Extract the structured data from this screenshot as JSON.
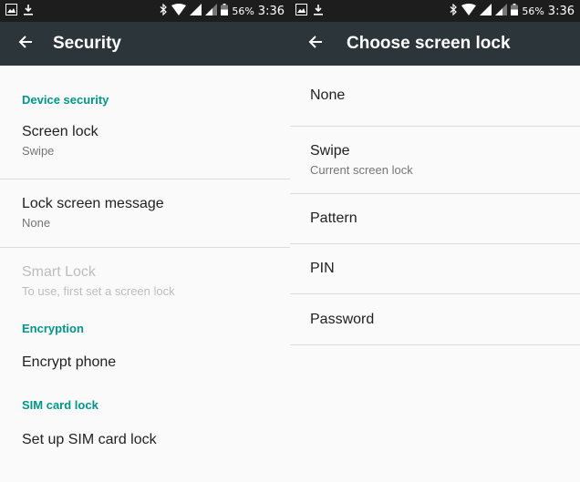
{
  "left": {
    "status": {
      "battery": "56%",
      "time": "3:36"
    },
    "appbar": {
      "title": "Security"
    },
    "sections": {
      "device_security": "Device security",
      "encryption": "Encryption",
      "sim_card_lock": "SIM card lock"
    },
    "items": {
      "screen_lock": {
        "title": "Screen lock",
        "summary": "Swipe"
      },
      "lock_screen_message": {
        "title": "Lock screen message",
        "summary": "None"
      },
      "smart_lock": {
        "title": "Smart Lock",
        "summary": "To use, first set a screen lock"
      },
      "encrypt_phone": {
        "title": "Encrypt phone"
      },
      "set_up_sim": {
        "title": "Set up SIM card lock"
      }
    }
  },
  "right": {
    "status": {
      "battery": "56%",
      "time": "3:36"
    },
    "appbar": {
      "title": "Choose screen lock"
    },
    "options": [
      {
        "title": "None"
      },
      {
        "title": "Swipe",
        "summary": "Current screen lock"
      },
      {
        "title": "Pattern"
      },
      {
        "title": "PIN"
      },
      {
        "title": "Password"
      }
    ]
  },
  "colors": {
    "accent": "#009688",
    "appbar": "#2c3539",
    "statusbar": "#1d1d1d"
  }
}
